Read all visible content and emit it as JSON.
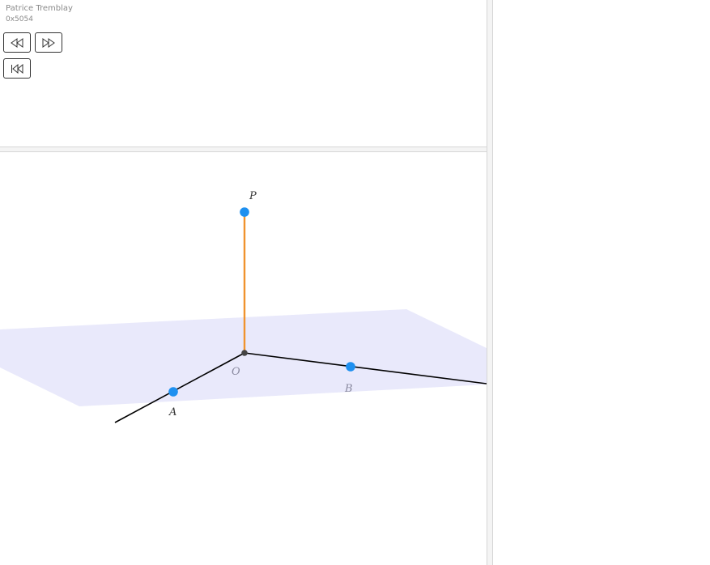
{
  "header": {
    "author": "Patrice Tremblay",
    "id": "0x5054"
  },
  "controls": {
    "rewind": {
      "icon": "rewind-icon"
    },
    "forward": {
      "icon": "fast-forward-icon"
    },
    "restart": {
      "icon": "skip-to-start-icon"
    }
  },
  "scene": {
    "points": {
      "P": "P",
      "O": "O",
      "A": "A",
      "B": "B"
    },
    "colors": {
      "plane": "#e9e9fb",
      "point": "#1e90f0",
      "origin": "#444444",
      "axis": "#000000",
      "segment": "#f0932e",
      "label_dark": "#333333",
      "label_muted": "#8a8aa0"
    }
  }
}
